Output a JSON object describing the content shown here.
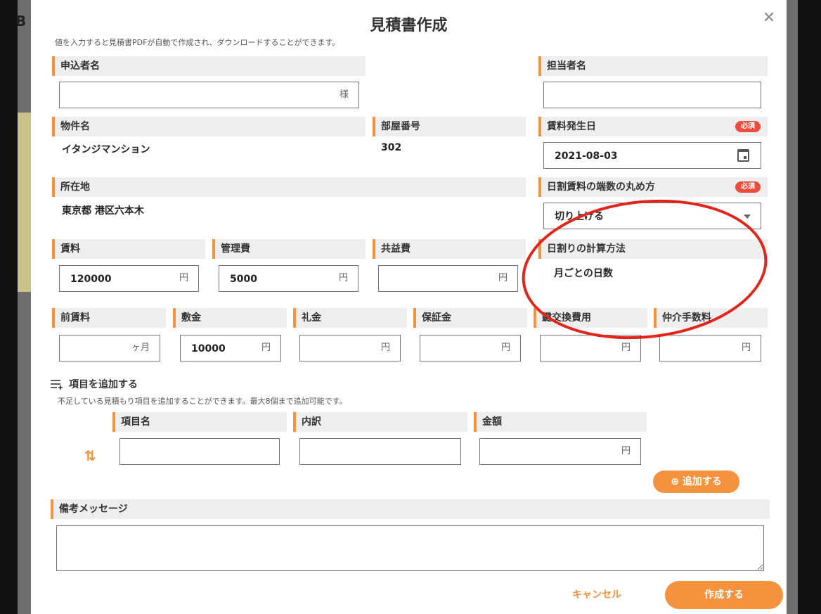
{
  "background": {
    "corner_text": "B"
  },
  "modal": {
    "title": "見積書作成",
    "close_icon": "close-icon",
    "subtitle": "値を入力すると見積書PDFが自動で作成され、ダウンロードすることができます。"
  },
  "applicant": {
    "label": "申込者名",
    "value": "",
    "suffix": "様"
  },
  "staff": {
    "label": "担当者名",
    "value": ""
  },
  "property": {
    "label": "物件名",
    "value": "イタンジマンション"
  },
  "room": {
    "label": "部屋番号",
    "value": "302"
  },
  "rent_start": {
    "label": "賃料発生日",
    "required": "必須",
    "value": "2021-08-03",
    "icon": "calendar-icon"
  },
  "address": {
    "label": "所在地",
    "value": "東京都 港区六本木"
  },
  "rounding": {
    "label": "日割賃料の端数の丸め方",
    "required": "必須",
    "value": "切り上げる",
    "icon": "chevron-down-icon"
  },
  "calc_method": {
    "label": "日割りの計算方法",
    "value": "月ごとの日数"
  },
  "fees": {
    "rent": {
      "label": "賃料",
      "value": "120000",
      "unit": "円"
    },
    "management": {
      "label": "管理費",
      "value": "5000",
      "unit": "円"
    },
    "common": {
      "label": "共益費",
      "value": "",
      "unit": "円"
    },
    "advance_rent": {
      "label": "前賃料",
      "value": "",
      "unit": "ヶ月"
    },
    "deposit": {
      "label": "敷金",
      "value": "10000",
      "unit": "円"
    },
    "key_money": {
      "label": "礼金",
      "value": "",
      "unit": "円"
    },
    "guarantee": {
      "label": "保証金",
      "value": "",
      "unit": "円"
    },
    "key_exchange": {
      "label": "鍵交換費用",
      "value": "",
      "unit": "円"
    },
    "brokerage": {
      "label": "仲介手数料",
      "value": "",
      "unit": "円"
    }
  },
  "extra_items": {
    "title": "項目を追加する",
    "title_icon": "add-list-icon",
    "description": "不足している見積もり項目を追加することができます。最大8個まで追加可能です。",
    "name_label": "項目名",
    "detail_label": "内訳",
    "amount_label": "金額",
    "amount_unit": "円",
    "sort_icon": "sort-icon",
    "add_button": "⊕ 追加する"
  },
  "memo": {
    "label": "備考メッセージ",
    "value": ""
  },
  "actions": {
    "cancel": "キャンセル",
    "submit": "作成する"
  },
  "colors": {
    "accent": "#f5923e",
    "required": "#ee4b3b",
    "annotation": "#e3241b"
  }
}
